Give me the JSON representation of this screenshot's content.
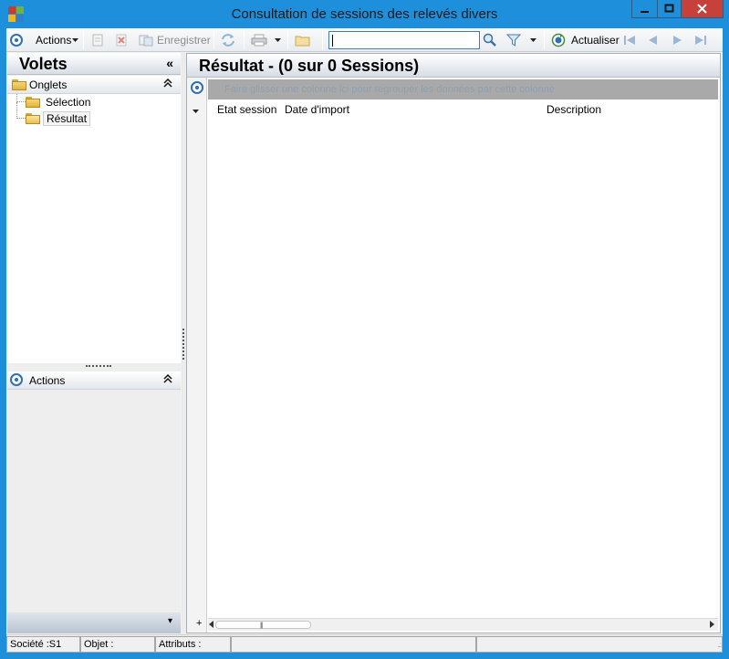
{
  "window": {
    "title": "Consultation de sessions des relevés divers",
    "colors": {
      "titlebar": "#1e8fda",
      "close_button": "#c7413a"
    }
  },
  "toolbar": {
    "actions_label": "Actions",
    "save_label": "Enregistrer",
    "search_value": "",
    "refresh_label": "Actualiser",
    "icons": [
      "target-icon",
      "new-document-icon",
      "delete-icon",
      "save-icon",
      "sync-icon",
      "print-icon",
      "folder-icon",
      "magnifier-icon",
      "filter-icon",
      "refresh-icon",
      "first-record-icon",
      "previous-record-icon",
      "next-record-icon",
      "last-record-icon"
    ]
  },
  "left_panel": {
    "title": "Volets",
    "collapse_glyph": "«",
    "tabs_group": {
      "label": "Onglets",
      "chevron": "⌃",
      "items": [
        {
          "label": "Sélection",
          "selected": false
        },
        {
          "label": "Résultat",
          "selected": true
        }
      ]
    },
    "actions_group": {
      "label": "Actions",
      "chevron": "⌃"
    },
    "bottom_chevron": "▾"
  },
  "result_panel": {
    "title": "Résultat - (0 sur 0 Sessions)",
    "group_hint": "Faire glisser une colonne ici pour regrouper les données par cette colonne",
    "columns": [
      "Etat session",
      "Date d'import",
      "Description"
    ],
    "rows": [],
    "hscroll_plus": "+",
    "hscroll_grip": "|||"
  },
  "status_bar": {
    "company": "Société :S1",
    "object": "Objet :",
    "attributes": "Attributs :",
    "grip": "..:"
  }
}
